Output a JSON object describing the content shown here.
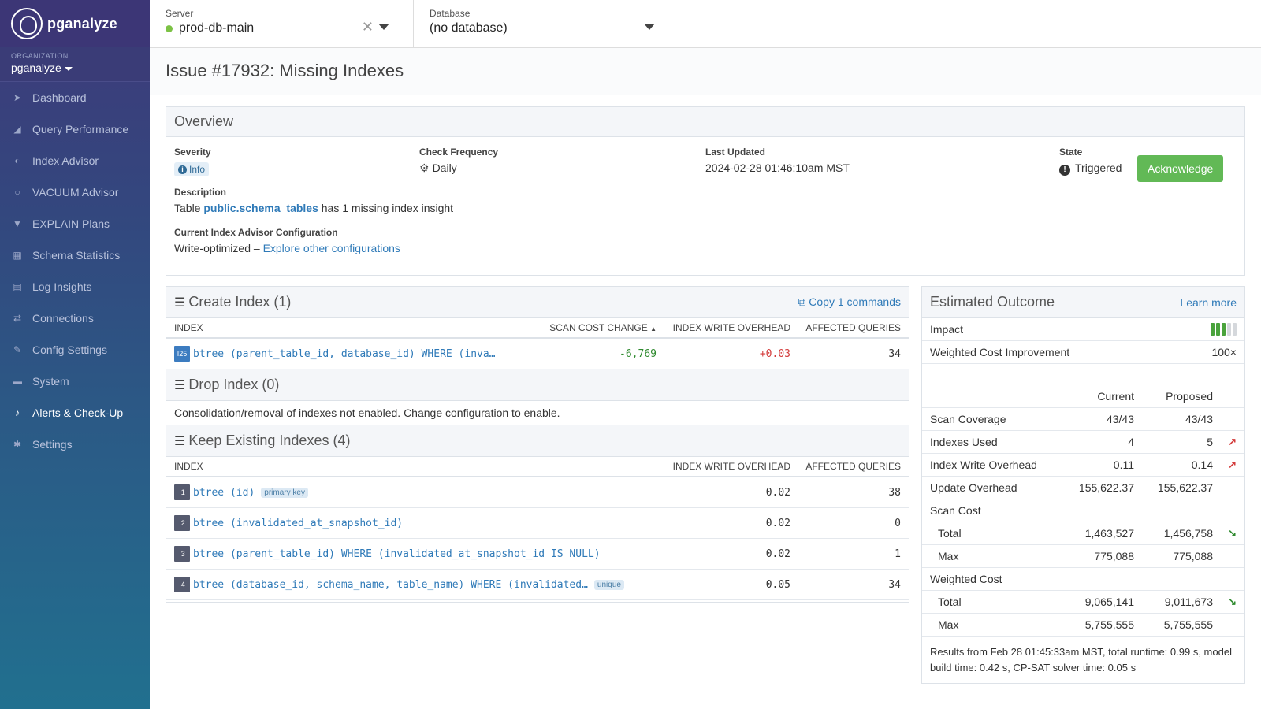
{
  "app": {
    "name": "pganalyze"
  },
  "org": {
    "caption": "ORGANIZATION",
    "name": "pganalyze"
  },
  "nav": [
    {
      "label": "Dashboard",
      "icon": "rocket-icon"
    },
    {
      "label": "Query Performance",
      "icon": "chart-icon"
    },
    {
      "label": "Index Advisor",
      "icon": "index-icon"
    },
    {
      "label": "VACUUM Advisor",
      "icon": "vacuum-icon"
    },
    {
      "label": "EXPLAIN Plans",
      "icon": "filter-icon"
    },
    {
      "label": "Schema Statistics",
      "icon": "table-icon"
    },
    {
      "label": "Log Insights",
      "icon": "log-icon"
    },
    {
      "label": "Connections",
      "icon": "connections-icon"
    },
    {
      "label": "Config Settings",
      "icon": "wrench-icon"
    },
    {
      "label": "System",
      "icon": "server-icon"
    },
    {
      "label": "Alerts & Check-Up",
      "icon": "bell-icon"
    },
    {
      "label": "Settings",
      "icon": "gear-icon"
    }
  ],
  "topbar": {
    "server_caption": "Server",
    "server_value": "prod-db-main",
    "database_caption": "Database",
    "database_value": "(no database)"
  },
  "page": {
    "title": "Issue #17932: Missing Indexes"
  },
  "overview": {
    "title": "Overview",
    "severity_label": "Severity",
    "severity_value": "Info",
    "frequency_label": "Check Frequency",
    "frequency_value": "Daily",
    "updated_label": "Last Updated",
    "updated_value": "2024-02-28 01:46:10am MST",
    "state_label": "State",
    "state_value": "Triggered",
    "ack_label": "Acknowledge",
    "description_label": "Description",
    "description_prefix": "Table",
    "description_table": "public.schema_tables",
    "description_suffix": "has 1 missing index insight",
    "config_label": "Current Index Advisor Configuration",
    "config_value": "Write-optimized –",
    "config_link": "Explore other configurations"
  },
  "create_index": {
    "title": "Create Index (1)",
    "copy_label": "Copy 1 commands",
    "headers": [
      "INDEX",
      "SCAN COST CHANGE",
      "INDEX WRITE OVERHEAD",
      "AFFECTED QUERIES"
    ],
    "rows": [
      {
        "tag": "I25",
        "def": "btree (parent_table_id, database_id) WHERE (inva…",
        "scan": "-6,769",
        "overhead": "+0.03",
        "queries": "34"
      }
    ]
  },
  "drop_index": {
    "title": "Drop Index (0)",
    "message": "Consolidation/removal of indexes not enabled. Change configuration to enable."
  },
  "keep_index": {
    "title": "Keep Existing Indexes (4)",
    "headers": [
      "INDEX",
      "INDEX WRITE OVERHEAD",
      "AFFECTED QUERIES"
    ],
    "rows": [
      {
        "tag": "I1",
        "def": "btree (id)",
        "pill": "primary key",
        "overhead": "0.02",
        "queries": "38"
      },
      {
        "tag": "I2",
        "def": "btree (invalidated_at_snapshot_id)",
        "pill": "",
        "overhead": "0.02",
        "queries": "0"
      },
      {
        "tag": "I3",
        "def": "btree (parent_table_id) WHERE (invalidated_at_snapshot_id IS NULL)",
        "pill": "",
        "overhead": "0.02",
        "queries": "1"
      },
      {
        "tag": "I4",
        "def": "btree (database_id, schema_name, table_name) WHERE (invalidated…",
        "pill": "unique",
        "overhead": "0.05",
        "queries": "34"
      }
    ]
  },
  "outcome": {
    "title": "Estimated Outcome",
    "learn_more": "Learn more",
    "impact_label": "Impact",
    "impact_level": 3,
    "impact_max": 5,
    "weighted_label": "Weighted Cost Improvement",
    "weighted_value": "100×",
    "col_current": "Current",
    "col_proposed": "Proposed",
    "rows": [
      {
        "label": "Scan Coverage",
        "current": "43/43",
        "proposed": "43/43",
        "trend": "",
        "indent": false
      },
      {
        "label": "Indexes Used",
        "current": "4",
        "proposed": "5",
        "trend": "up",
        "indent": false
      },
      {
        "label": "Index Write Overhead",
        "current": "0.11",
        "proposed": "0.14",
        "trend": "up",
        "indent": false
      },
      {
        "label": "Update Overhead",
        "current": "155,622.37",
        "proposed": "155,622.37",
        "trend": "",
        "indent": false
      },
      {
        "label": "Scan Cost",
        "current": "",
        "proposed": "",
        "trend": "",
        "indent": false
      },
      {
        "label": "Total",
        "current": "1,463,527",
        "proposed": "1,456,758",
        "trend": "down",
        "indent": true
      },
      {
        "label": "Max",
        "current": "775,088",
        "proposed": "775,088",
        "trend": "",
        "indent": true
      },
      {
        "label": "Weighted Cost",
        "current": "",
        "proposed": "",
        "trend": "",
        "indent": false
      },
      {
        "label": "Total",
        "current": "9,065,141",
        "proposed": "9,011,673",
        "trend": "down",
        "indent": true
      },
      {
        "label": "Max",
        "current": "5,755,555",
        "proposed": "5,755,555",
        "trend": "",
        "indent": true
      }
    ],
    "footer": "Results from Feb 28 01:45:33am MST, total runtime: 0.99 s, model build time: 0.42 s, CP-SAT solver time: 0.05 s"
  }
}
